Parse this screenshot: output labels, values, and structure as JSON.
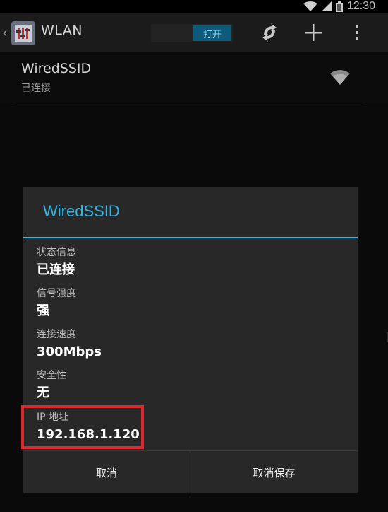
{
  "status_bar": {
    "time": "12:30"
  },
  "action_bar": {
    "title": "WLAN",
    "switch_label": "打开",
    "icons": [
      "back-chevron-icon",
      "settings-app-icon",
      "refresh-icon",
      "add-icon",
      "overflow-menu-icon"
    ]
  },
  "network": {
    "ssid": "WiredSSID",
    "status": "已连接"
  },
  "dialog": {
    "title": "WiredSSID",
    "fields": [
      {
        "label": "状态信息",
        "value": "已连接"
      },
      {
        "label": "信号强度",
        "value": "强"
      },
      {
        "label": "连接速度",
        "value": "300Mbps"
      },
      {
        "label": "安全性",
        "value": "无"
      },
      {
        "label": "IP 地址",
        "value": "192.168.1.120"
      }
    ],
    "buttons": {
      "cancel": "取消",
      "forget": "取消保存"
    }
  },
  "colors": {
    "accent": "#33b5e5",
    "highlight": "#e0262a"
  }
}
